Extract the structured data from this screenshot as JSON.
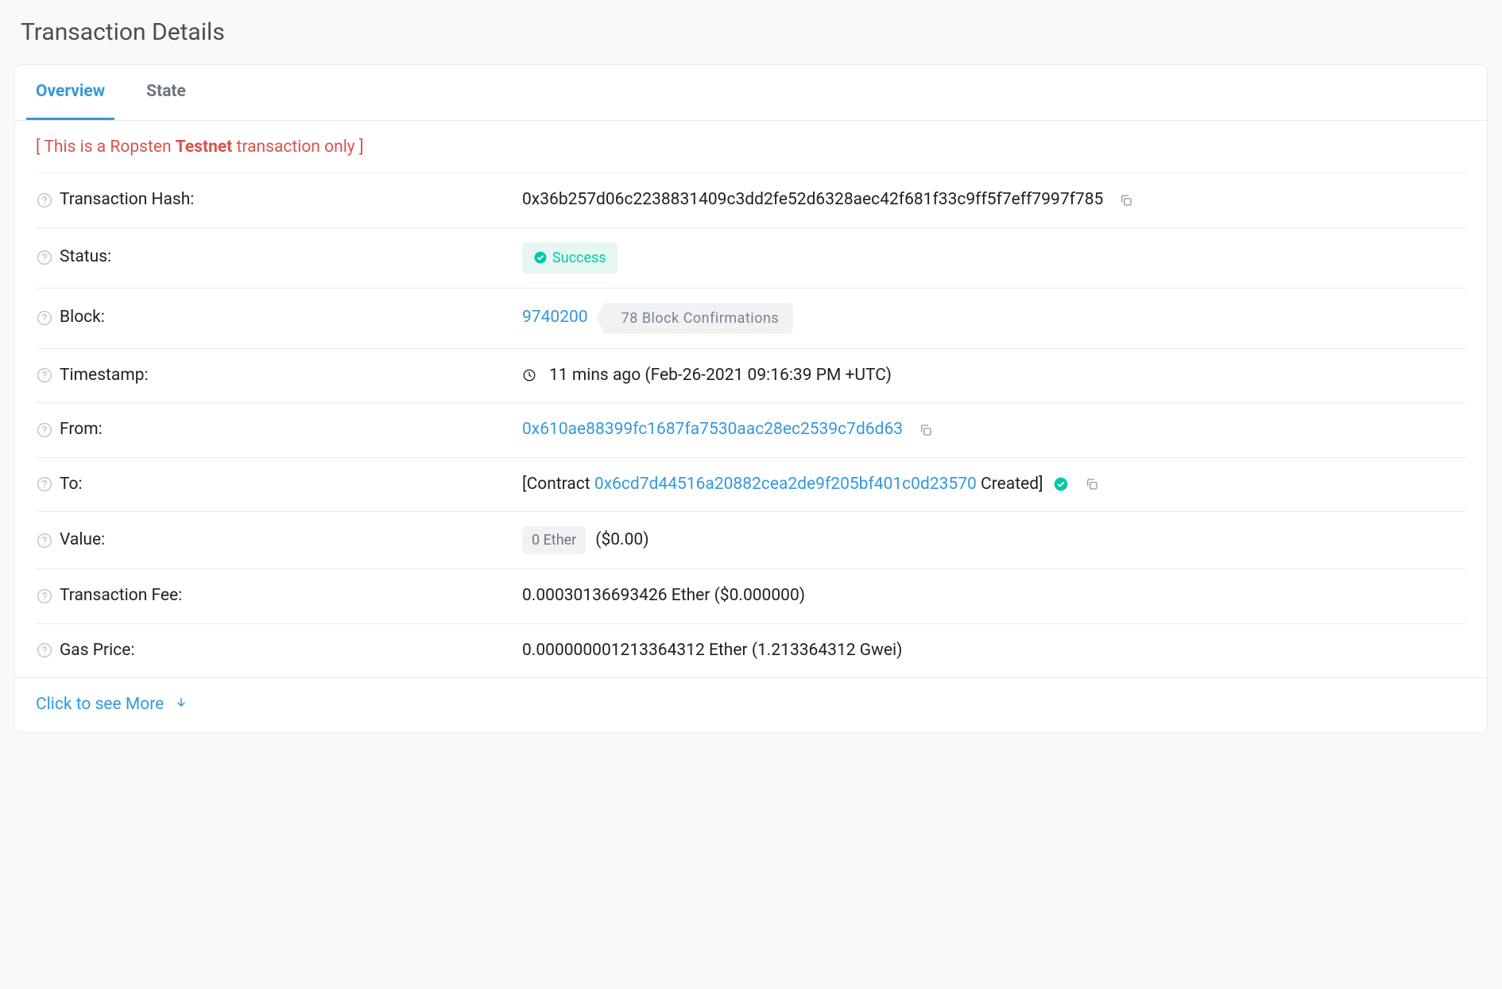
{
  "page_title": "Transaction Details",
  "tabs": {
    "overview": "Overview",
    "state": "State"
  },
  "banner": {
    "prefix": "[ This is a Ropsten ",
    "bold": "Testnet",
    "suffix": " transaction only ]"
  },
  "labels": {
    "hash": "Transaction Hash:",
    "status": "Status:",
    "block": "Block:",
    "timestamp": "Timestamp:",
    "from": "From:",
    "to": "To:",
    "value": "Value:",
    "fee": "Transaction Fee:",
    "gas_price": "Gas Price:"
  },
  "values": {
    "hash": "0x36b257d06c2238831409c3dd2fe52d6328aec42f681f33c9ff5f7eff7997f785",
    "status": "Success",
    "block": "9740200",
    "confirmations": "78 Block Confirmations",
    "timestamp": "11 mins ago (Feb-26-2021 09:16:39 PM +UTC)",
    "from": "0x610ae88399fc1687fa7530aac28ec2539c7d6d63",
    "to_prefix": "[Contract ",
    "to_address": "0x6cd7d44516a20882cea2de9f205bf401c0d23570",
    "to_suffix": " Created]",
    "value_badge": "0 Ether",
    "value_usd": "($0.00)",
    "fee": "0.00030136693426 Ether ($0.000000)",
    "gas_price": "0.000000001213364312 Ether (1.213364312 Gwei)"
  },
  "see_more": "Click to see More"
}
